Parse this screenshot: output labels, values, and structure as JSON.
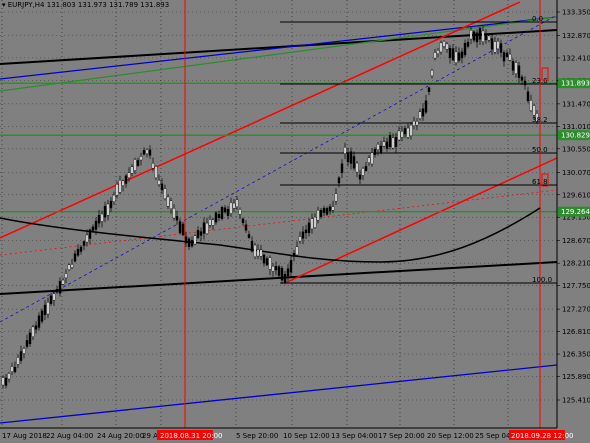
{
  "header": {
    "symbol": "EURJPY,H4",
    "ohlc": "131.803 131.973 131.789 131.893"
  },
  "price_axis": {
    "ticks": [
      "133.350",
      "132.870",
      "132.410",
      "131.950",
      "131.470",
      "131.010",
      "130.550",
      "130.070",
      "129.610",
      "129.150",
      "128.670",
      "128.210",
      "127.750",
      "127.270",
      "126.810",
      "126.350",
      "125.890",
      "125.410"
    ]
  },
  "price_tags": [
    {
      "value": "131.893",
      "color": "#2e8b2e"
    },
    {
      "value": "130.829",
      "color": "#2e8b2e"
    },
    {
      "value": "129.264",
      "color": "#2e8b2e"
    }
  ],
  "time_axis": {
    "labels": [
      "17 Aug 2018",
      "22 Aug 04:00",
      "24 Aug 20:00",
      "29 A",
      "5 Sep 20:00",
      "10 Sep 12:00",
      "13 Sep 04:00",
      "17 Sep 20:00",
      "20 Sep 12:00",
      "25 Sep 04:00"
    ],
    "highlight_1": "2018.08.31 20:00",
    "highlight_2": "2018.09.28 12:00"
  },
  "fibo": {
    "levels": [
      "0.0",
      "23.6",
      "38.2",
      "50.0",
      "61.8",
      "100.0"
    ]
  },
  "colors": {
    "background": "#808080",
    "bull": "#ffffff",
    "bear": "#000000",
    "channel": "#ff0000",
    "support": "#2e8b2e",
    "trend_blue": "#0000cc"
  }
}
